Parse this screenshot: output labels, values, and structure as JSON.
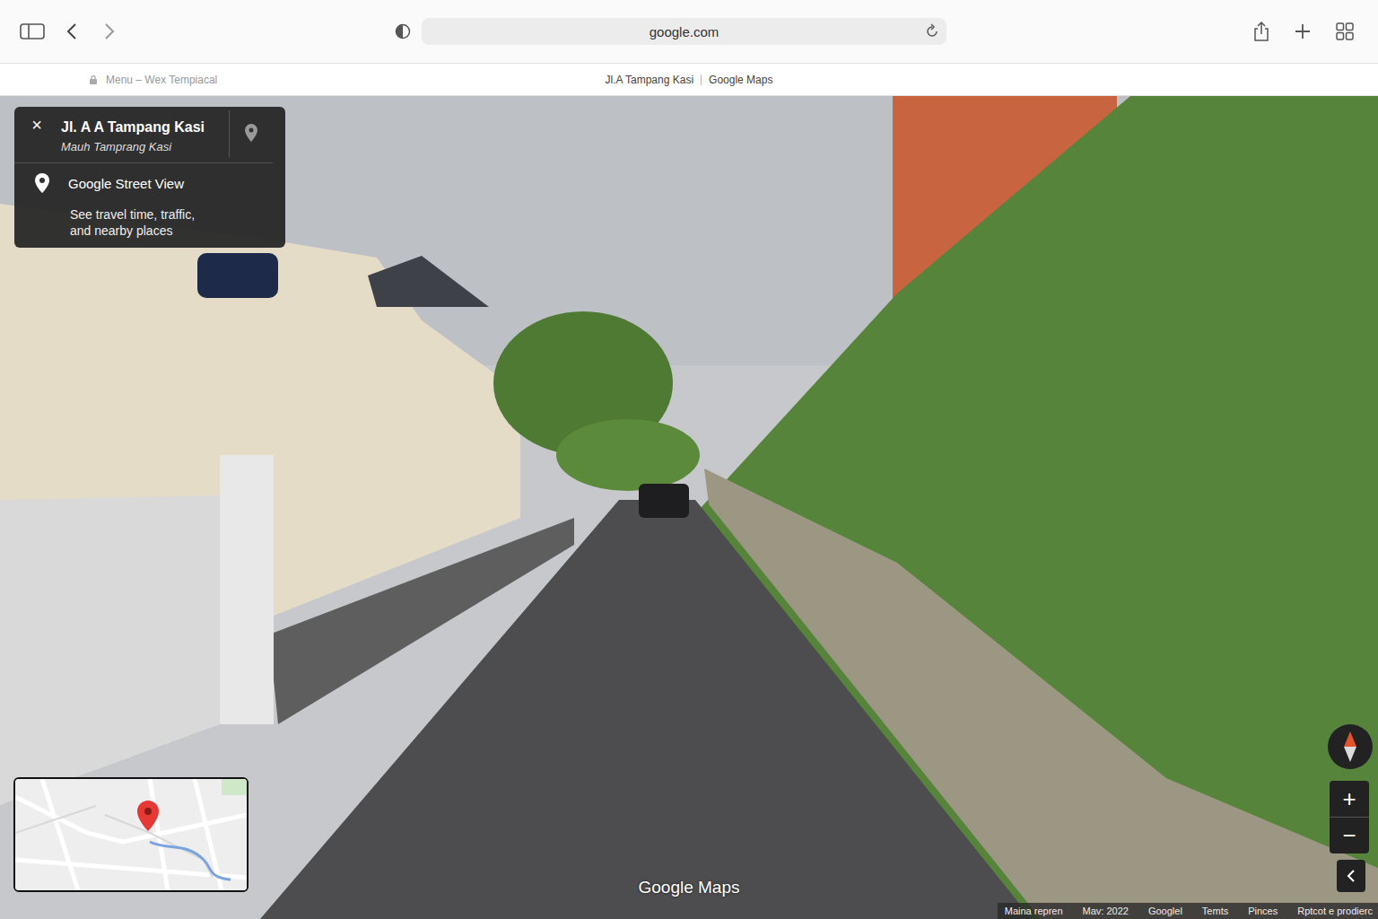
{
  "browser": {
    "url": "google.com"
  },
  "tab_bar": {
    "left_label": "Menu – Wex Tempiacal",
    "title": "Jl.A Tampang Kasi",
    "site": "Google Maps"
  },
  "info_card": {
    "close": "×",
    "title": "Jl. A A Tampang Kasi",
    "subtitle": "Mauh Tamprang Kasi",
    "heading": "Google Street View",
    "description_lines": [
      "See travel time, traffic,",
      "and nearby places"
    ]
  },
  "logo": "Google Maps",
  "controls": {
    "zoom_in": "+",
    "zoom_out": "−"
  },
  "footer": [
    "Maina repren",
    "Mav: 2022",
    "Googlel",
    "Temts",
    "Pinces",
    "Rptcot e prodierc"
  ]
}
